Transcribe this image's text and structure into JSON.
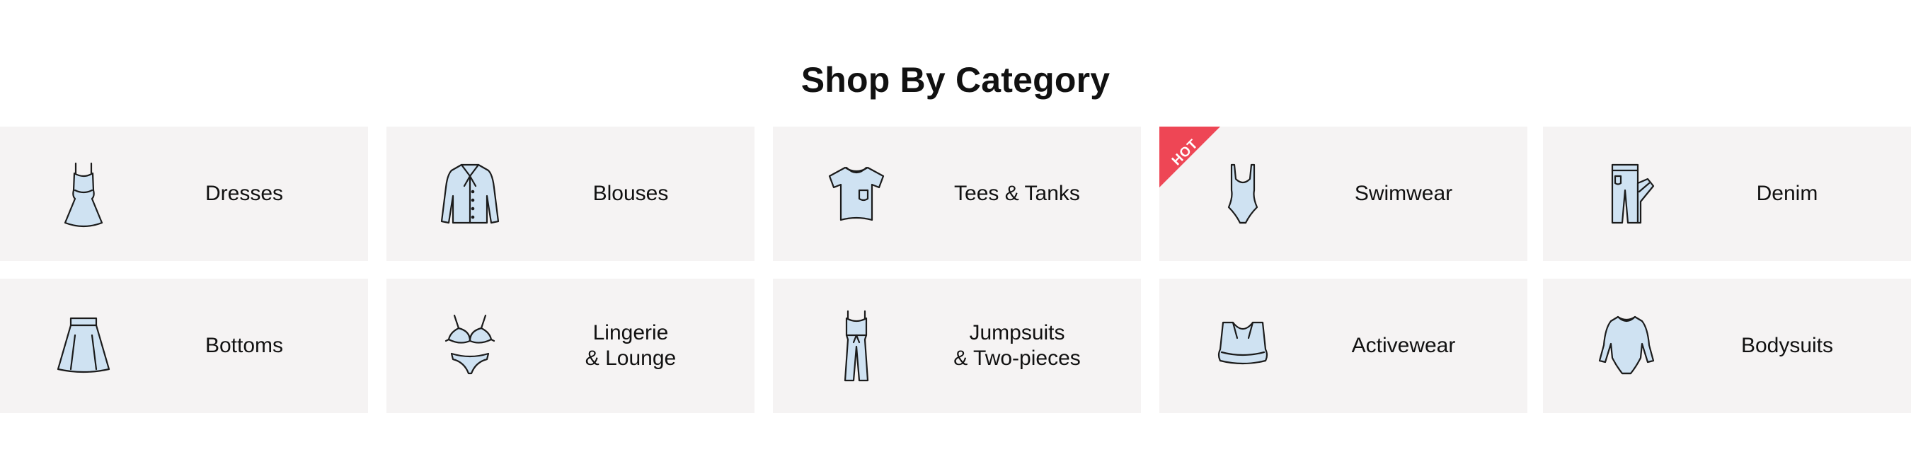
{
  "section": {
    "title": "Shop By Category"
  },
  "badge": {
    "hot_label": "HOT",
    "color": "#ee4655"
  },
  "colors": {
    "tile_background": "#f5f3f3",
    "icon_fill": "#cfe2f2",
    "icon_stroke": "#1b1b1b"
  },
  "categories": [
    {
      "label_line1": "Dresses",
      "label_line2": "",
      "icon": "dress-icon"
    },
    {
      "label_line1": "Blouses",
      "label_line2": "",
      "icon": "blouse-icon"
    },
    {
      "label_line1": "Tees & Tanks",
      "label_line2": "",
      "icon": "tshirt-icon"
    },
    {
      "label_line1": "Swimwear",
      "label_line2": "",
      "icon": "swimsuit-icon",
      "badge": "HOT"
    },
    {
      "label_line1": "Denim",
      "label_line2": "",
      "icon": "jeans-icon"
    },
    {
      "label_line1": "Bottoms",
      "label_line2": "",
      "icon": "skirt-icon"
    },
    {
      "label_line1": "Lingerie",
      "label_line2": "& Lounge",
      "icon": "lingerie-icon"
    },
    {
      "label_line1": "Jumpsuits",
      "label_line2": "& Two-pieces",
      "icon": "jumpsuit-icon"
    },
    {
      "label_line1": "Activewear",
      "label_line2": "",
      "icon": "sports-bra-icon"
    },
    {
      "label_line1": "Bodysuits",
      "label_line2": "",
      "icon": "bodysuit-icon"
    }
  ]
}
